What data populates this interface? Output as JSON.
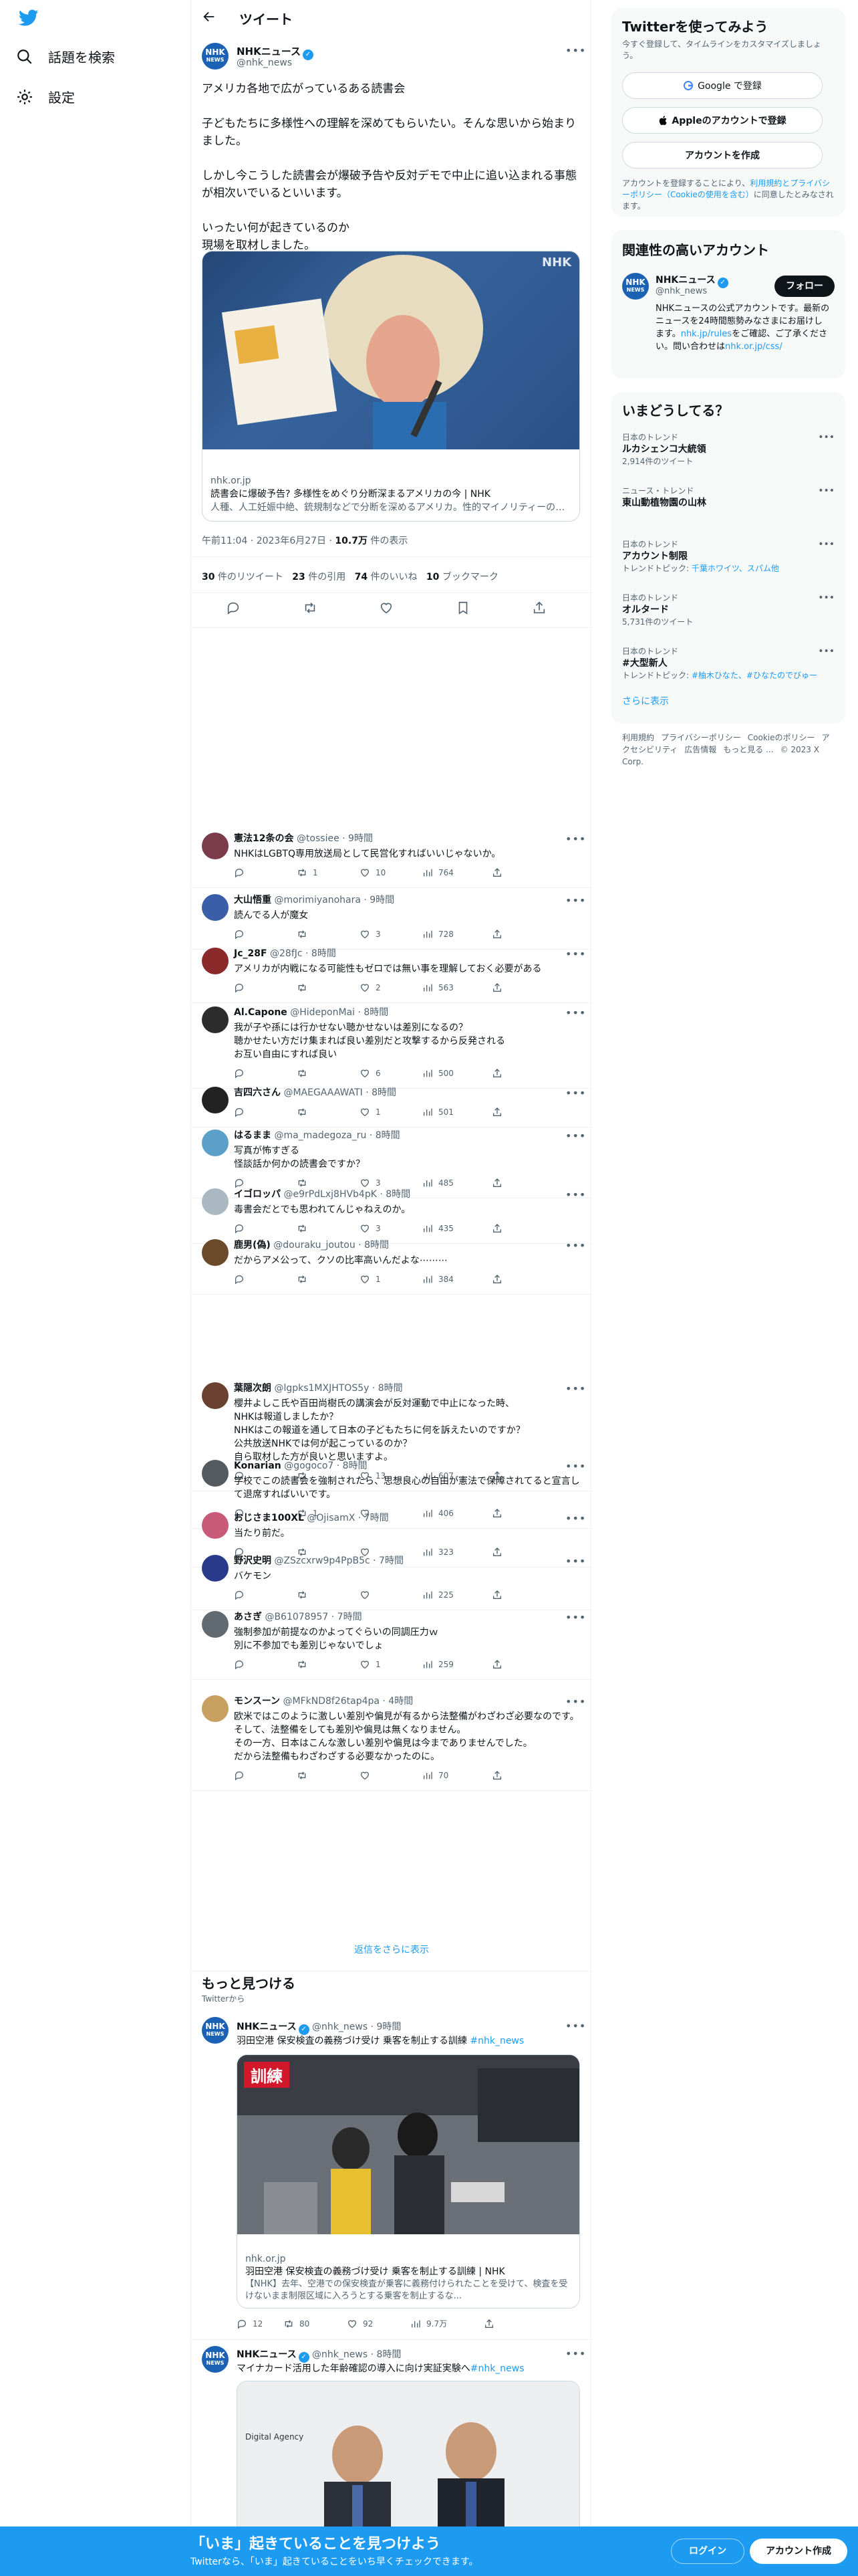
{
  "nav": {
    "explore": "話題を検索",
    "settings": "設定"
  },
  "header": {
    "title": "ツイート"
  },
  "tweet": {
    "author": "NHKニュース",
    "handle": "@nhk_news",
    "text": "アメリカ各地で広がっているある読書会\n\n子どもたちに多様性への理解を深めてもらいたい。そんな思いから始まりました。\n\nしかし今こうした読書会が爆破予告や反対デモで中止に追い込まれる事態が相次いでいるといいます。\n\nいったい何が起きているのか\n現場を取材しました。",
    "card_domain": "nhk.or.jp",
    "card_title": "読書会に爆破予告? 多様性をめぐり分断深まるアメリカの今 | NHK",
    "card_desc": "人種、人工妊娠中絶、銃規制などで分断を深めるアメリカ。性的マイノリティーの人たちの権利をめぐる議論でもその分断が浮き彫りになっています。何が起...",
    "time": "午前11:04 · 2023年6月27日 · ",
    "views": "10.7万",
    "views_label": " 件の表示",
    "retweets": "30",
    "retweets_label": " 件のリツイート",
    "quotes": "23",
    "quotes_label": " 件の引用",
    "likes": "74",
    "likes_label": " 件のいいね",
    "bookmarks": "10",
    "bookmarks_label": " ブックマーク"
  },
  "replies": [
    {
      "name": "憲法12条の会",
      "handle": "@tossiee · 9時間",
      "text": "NHKはLGBTQ専用放送局として民営化すればいいじゃないか。",
      "rt": "1",
      "likes": "10",
      "views": "764",
      "color": "#7a3b4a"
    },
    {
      "name": "大山悟重",
      "handle": "@morimiyanohara · 9時間",
      "text": "読んでる人が魔女",
      "rt": "",
      "likes": "3",
      "views": "728",
      "color": "#3b5ea8"
    },
    {
      "name": "Jc_28F",
      "handle": "@28fJc · 8時間",
      "text": "アメリカが内戦になる可能性もゼロでは無い事を理解しておく必要がある",
      "rt": "",
      "likes": "2",
      "views": "563",
      "color": "#8a2a2a"
    },
    {
      "name": "Al.Capone",
      "handle": "@HideponMai · 8時間",
      "text": "我が子や孫には行かせない聴かせないは差別になるの？\n聴かせたい方だけ集まれば良い差別だと攻撃するから反発される\nお互い自由にすれば良い",
      "rt": "",
      "likes": "6",
      "views": "500",
      "color": "#2c2c2c"
    },
    {
      "name": "吉四六さん",
      "handle": "@MAEGAAAWATI · 8時間",
      "text": "",
      "rt": "",
      "likes": "1",
      "views": "501",
      "color": "#222222"
    },
    {
      "name": "はるまま",
      "handle": "@ma_madegoza_ru · 8時間",
      "text": "写真が怖すぎる\n怪談話か何かの読書会ですか？",
      "rt": "",
      "likes": "3",
      "views": "485",
      "color": "#5aa0c8"
    },
    {
      "name": "イゴロッパ",
      "handle": "@e9rPdLxj8HVb4pK · 8時間",
      "text": "毒書会だとでも思われてんじゃねえのか。",
      "rt": "",
      "likes": "3",
      "views": "435",
      "color": "#aab8c2"
    },
    {
      "name": "鹿男(偽)",
      "handle": "@douraku_joutou · 8時間",
      "text": "だからアメ公って、クソの比率高いんだよな⋯⋯⋯",
      "rt": "",
      "likes": "1",
      "views": "384",
      "color": "#6b4a2a"
    },
    {
      "name": "葉隠次朗",
      "handle": "@lgpks1MXJHTOS5y · 8時間",
      "text": "櫻井よしこ氏や百田尚樹氏の講演会が反対運動で中止になった時、\nNHKは報道しましたか？\nNHKはこの報道を通して日本の子どもたちに何を訴えたいのですか？\n公共放送NHKでは何が起こっているのか？\n自ら取材した方が良いと思いますよ。",
      "rt": "",
      "likes": "13",
      "views": "607",
      "color": "#6a4030"
    },
    {
      "name": "Konarian",
      "handle": "@gogoco7 · 8時間",
      "text": "学校でこの読書会を強制されたら、思想良心の自由が憲法で保障されてると宣言して退席すればいいです。",
      "rt": "1",
      "likes": "",
      "views": "406",
      "color": "#555a60"
    },
    {
      "name": "おじさま100XL",
      "handle": "@OjisamX · 7時間",
      "text": "当たり前だ。",
      "rt": "",
      "likes": "",
      "views": "323",
      "color": "#c85a7a"
    },
    {
      "name": "野沢史明",
      "handle": "@ZSzcxrw9p4PpB5c · 7時間",
      "text": "バケモン",
      "rt": "",
      "likes": "",
      "views": "225",
      "color": "#2a3a8a"
    },
    {
      "name": "あさぎ",
      "handle": "@B61078957 · 7時間",
      "text": "強制参加が前提なのかよってぐらいの同調圧力ｗ\n別に不参加でも差別じゃないでしょ",
      "rt": "",
      "likes": "1",
      "views": "259",
      "color": "#606a70"
    },
    {
      "name": "モンスーン",
      "handle": "@MFkND8f26tap4pa · 4時間",
      "text": "欧米ではこのように激しい差別や偏見が有るから法整備がわざわざ必要なのです。\nそして、法整備をしても差別や偏見は無くなりません。\nその一方、日本はこんな激しい差別や偏見は今までありませんでした。\nだから法整備もわざわざする必要なかったのに。",
      "rt": "",
      "likes": "",
      "views": "70",
      "color": "#c8a060"
    }
  ],
  "show_more": "返信をさらに表示",
  "more": {
    "title": "もっと見つける",
    "subtitle": "Twitterから",
    "tweets": [
      {
        "name": "NHKニュース",
        "handle": "@nhk_news · 9時間",
        "text": "羽田空港 保安検査の義務づけ受け 乗客を制止する訓練",
        "tag": "#nhk_news",
        "badge": "訓練",
        "card_domain": "nhk.or.jp",
        "card_title": "羽田空港 保安検査の義務づけ受け 乗客を制止する訓練 | NHK",
        "card_desc": "【NHK】去年、空港での保安検査が乗客に義務付けられたことを受けて、検査を受けないまま制限区域に入ろうとする乗客を制止するな...",
        "replies": "12",
        "rt": "80",
        "likes": "92",
        "views": "9.7万"
      },
      {
        "name": "NHKニュース",
        "handle": "@nhk_news · 8時間",
        "text": "マイナカード活用した年齢確認の導入に向け実証実験へ",
        "tag": "#nhk_news",
        "img_text": "Digital Agency"
      }
    ]
  },
  "right": {
    "signup": {
      "title": "Twitterを使ってみよう",
      "sub": "今すぐ登録して、タイムラインをカスタマイズしましょう。",
      "google": "Google で登録",
      "apple": "Appleのアカウントで登録",
      "create": "アカウントを作成",
      "terms_pre": "アカウントを登録することにより、",
      "terms_link": "利用規約とプライバシーポリシー（Cookieの使用を含む）",
      "terms_post": "に同意したとみなされます。"
    },
    "relevant": {
      "title": "関連性の高いアカウント",
      "name": "NHKニュース",
      "handle": "@nhk_news",
      "follow": "フォロー",
      "bio_pre": "NHKニュースの公式アカウントです。最新のニュースを24時間態勢みなさまにお届けします。",
      "bio_link1": "nhk.jp/rules",
      "bio_mid": "をご確認、ご了承ください。問い合わせは",
      "bio_link2": "nhk.or.jp/css/"
    },
    "trends": {
      "title": "いまどうしてる？",
      "items": [
        {
          "cat": "日本のトレンド",
          "name": "ルカシェンコ大統領",
          "count": "2,914件のツイート"
        },
        {
          "cat": "ニュース・トレンド",
          "name": "東山動植物園の山林",
          "count": ""
        },
        {
          "cat": "日本のトレンド",
          "name": "アカウント制限",
          "count": "トレンドトピック: ",
          "count_link": "千葉ホワイツ、スパム他"
        },
        {
          "cat": "日本のトレンド",
          "name": "オルタード",
          "count": "5,731件のツイート"
        },
        {
          "cat": "日本のトレンド",
          "name": "#大型新人",
          "count": "トレンドトピック: ",
          "count_link": "#柚木ひなた、#ひなたのでびゅー"
        }
      ],
      "show_more": "さらに表示"
    },
    "footer": [
      "利用規約",
      "プライバシーポリシー",
      "Cookieのポリシー",
      "アクセシビリティ",
      "広告情報",
      "もっと見る ...",
      "© 2023 X Corp."
    ]
  },
  "bottom": {
    "title": "「いま」起きていることを見つけよう",
    "sub": "Twitterなら、「いま」起きていることをいち早くチェックできます。",
    "login": "ログイン",
    "signup": "アカウント作成"
  },
  "colors": {
    "accent": "#1d9bf0",
    "text": "#0f1419",
    "secondary": "#536471",
    "nhk": "#1b62b5"
  }
}
